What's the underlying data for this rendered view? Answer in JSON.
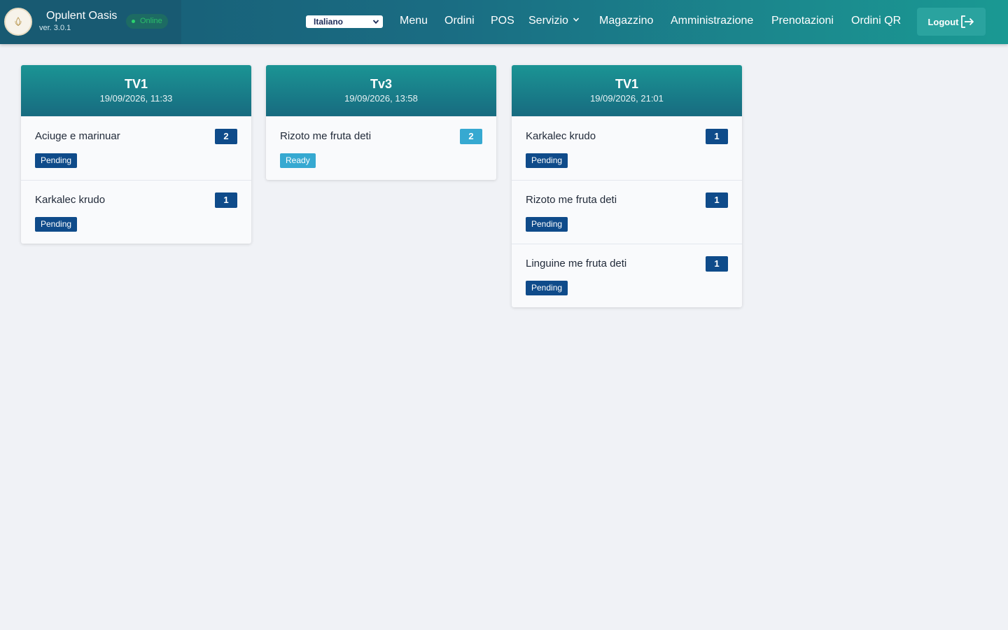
{
  "header": {
    "brand_name": "Opulent Oasis",
    "version": "ver. 3.0.1",
    "status": "Online",
    "language": "Italiano",
    "nav": [
      {
        "label": "Menu"
      },
      {
        "label": "Ordini"
      },
      {
        "label": "POS"
      },
      {
        "label": "Servizio"
      },
      {
        "label": "Magazzino"
      },
      {
        "label": "Amministrazione"
      },
      {
        "label": "Prenotazioni"
      },
      {
        "label": "Ordini QR"
      }
    ],
    "logout_label": "Logout"
  },
  "orders": [
    {
      "table": "TV1",
      "datetime": "19/09/2026, 11:33",
      "items": [
        {
          "name": "Aciuge e marinuar",
          "qty": "2",
          "status": "Pending"
        },
        {
          "name": "Karkalec krudo",
          "qty": "1",
          "status": "Pending"
        }
      ]
    },
    {
      "table": "Tv3",
      "datetime": "19/09/2026, 13:58",
      "items": [
        {
          "name": "Rizoto me fruta deti",
          "qty": "2",
          "status": "Ready"
        }
      ]
    },
    {
      "table": "TV1",
      "datetime": "19/09/2026, 21:01",
      "items": [
        {
          "name": "Karkalec krudo",
          "qty": "1",
          "status": "Pending"
        },
        {
          "name": "Rizoto me fruta deti",
          "qty": "1",
          "status": "Pending"
        },
        {
          "name": "Linguine me fruta deti",
          "qty": "1",
          "status": "Pending"
        }
      ]
    }
  ],
  "colors": {
    "pending": "#0f4b8a",
    "ready": "#36a9d1",
    "online": "#2bd26f"
  }
}
